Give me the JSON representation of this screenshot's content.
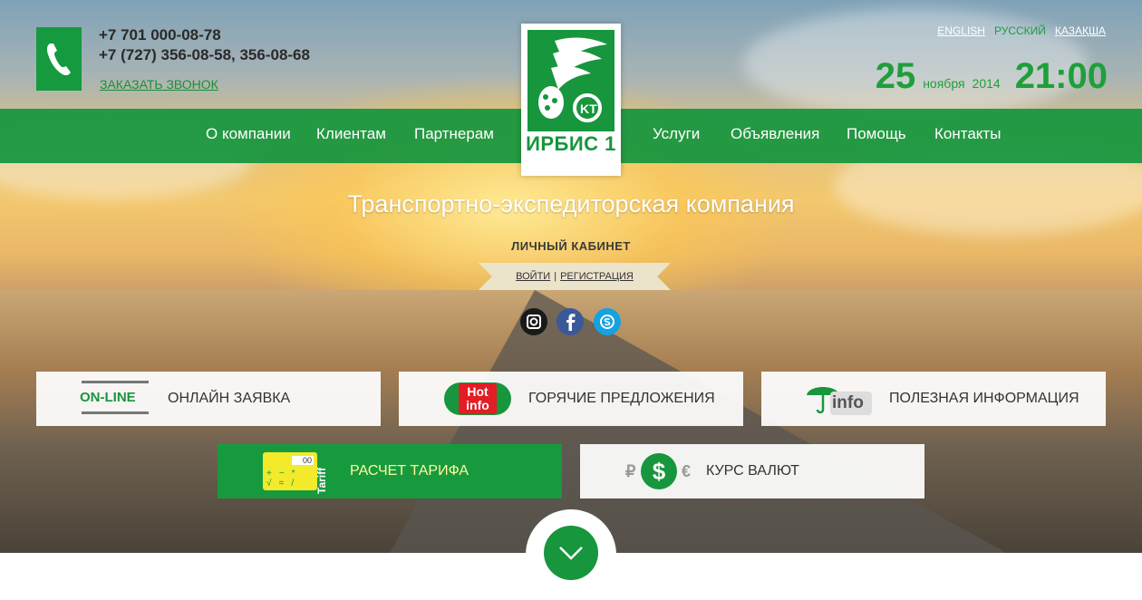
{
  "contact": {
    "phone1": "+7 701 000-08-78",
    "phone2": "+7 (727) 356-08-58, 356-08-68",
    "callback": "ЗАКАЗАТЬ ЗВОНОК"
  },
  "logo": {
    "brand": "ИРБИС 1"
  },
  "languages": [
    "ENGLISH",
    "РУССКИЙ",
    "ҚАЗАҚША"
  ],
  "active_language": "РУССКИЙ",
  "datetime": {
    "day": "25",
    "month": "ноября",
    "year": "2014",
    "time": "21:00"
  },
  "nav": {
    "left": [
      "О компании",
      "Клиентам",
      "Партнерам"
    ],
    "right": [
      "Услуги",
      "Объявления",
      "Помощь",
      "Контакты"
    ]
  },
  "tagline": "Транспортно-экспедиторская компания",
  "cabinet": {
    "title": "ЛИЧНЫЙ КАБИНЕТ",
    "login": "ВОЙТИ",
    "register": "РЕГИСТРАЦИЯ"
  },
  "social": [
    "instagram-icon",
    "facebook-icon",
    "skype-icon"
  ],
  "tiles": {
    "online": {
      "icon_text": "ON-LINE",
      "label": "ОНЛАЙН ЗАЯВКА"
    },
    "hot": {
      "icon_text1": "Hot",
      "icon_text2": "info",
      "label": "ГОРЯЧИЕ ПРЕДЛОЖЕНИЯ"
    },
    "info": {
      "icon_text": "info",
      "label": "ПОЛЕЗНАЯ ИНФОРМАЦИЯ"
    },
    "tariff": {
      "icon_text": "Tariff",
      "display": "00",
      "label": "РАСЧЕТ ТАРИФА"
    },
    "currency": {
      "sym_left": "₽",
      "sym_center": "$",
      "sym_right": "€",
      "label": "КУРС ВАЛЮТ"
    }
  },
  "colors": {
    "brand_green": "#17963d",
    "tariff_label": "#fff8a0"
  }
}
